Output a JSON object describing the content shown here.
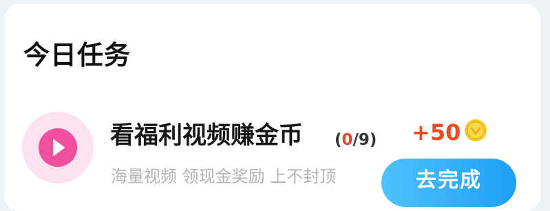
{
  "section": {
    "title": "今日任务"
  },
  "task": {
    "icon": "play-icon",
    "title": "看福利视频赚金币",
    "progress_open": "(",
    "progress_done": "0",
    "progress_rest": "/9)",
    "description": "海量视频 领现金奖励 上不封顶",
    "reward": "+50",
    "reward_icon": "gold-coin-icon",
    "button_label": "去完成"
  },
  "colors": {
    "icon_accent": "#f04fa0",
    "reward": "#f04a23",
    "button": "#1e9ff6"
  }
}
